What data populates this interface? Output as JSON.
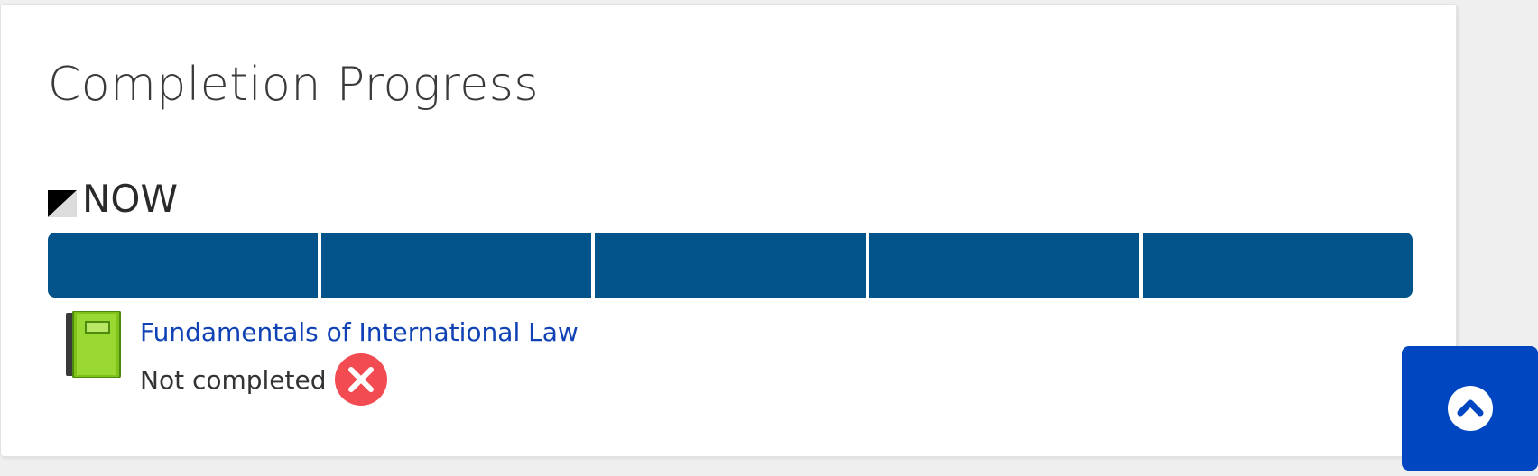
{
  "block": {
    "title": "Completion Progress",
    "now_label": "NOW"
  },
  "progress": {
    "segments": 5,
    "color": "#02538a"
  },
  "activities": [
    {
      "name": "Fundamentals of International Law",
      "status": "Not completed",
      "icon": "book-icon",
      "status_icon": "not-completed-icon"
    }
  ],
  "colors": {
    "link": "#1042b5",
    "bar": "#02538a",
    "not_completed": "#f24b52",
    "back_to_top": "#0046c0"
  },
  "back_to_top": {
    "icon": "chevron-up-icon"
  }
}
